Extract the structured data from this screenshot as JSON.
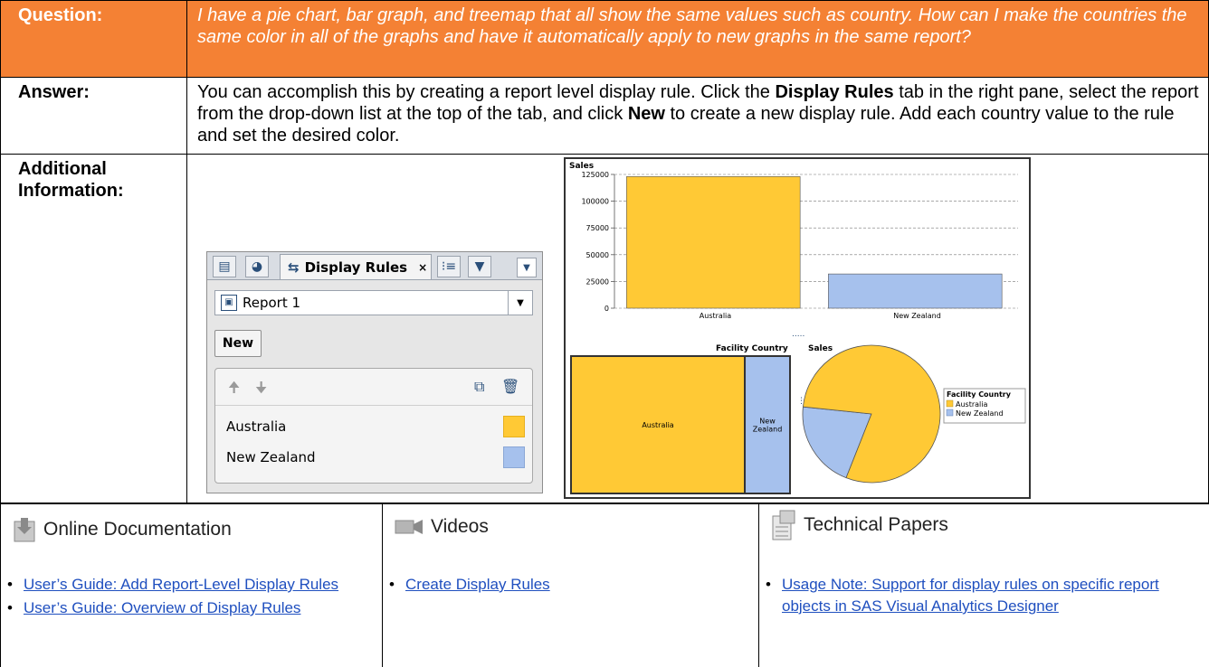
{
  "qa": {
    "question_label": "Question:",
    "question_text": "I have a pie chart, bar graph, and treemap that all show the same values such as country. How can I make the countries the same color in all of the graphs and have it automatically apply to new graphs in the same report?",
    "answer_label": "Answer:",
    "answer_part1": "You can accomplish this by creating a report level display rule. Click the ",
    "answer_bold1": "Display Rules",
    "answer_part2": " tab in the right pane, select the report from the drop-down list at the top of the tab, and click ",
    "answer_bold2": "New",
    "answer_part3": " to create a new display rule. Add each country value to the rule and set the desired color.",
    "additional_label": "Additional Information:"
  },
  "panel": {
    "tab_label": "Display Rules",
    "tab_close": "×",
    "report_value": "Report 1",
    "new_button": "New",
    "rules": [
      {
        "label": "Australia",
        "color": "#ffc935"
      },
      {
        "label": "New Zealand",
        "color": "#a6c1ed"
      }
    ]
  },
  "chart_data": [
    {
      "type": "bar",
      "title": "Sales",
      "categories": [
        "Australia",
        "New Zealand"
      ],
      "values": [
        123000,
        32000
      ],
      "ylim": [
        0,
        125000
      ],
      "yticks": [
        0,
        25000,
        50000,
        75000,
        100000,
        125000
      ],
      "colors": [
        "#ffc935",
        "#a6c1ed"
      ]
    },
    {
      "type": "treemap",
      "categories": [
        "Australia",
        "New Zealand"
      ],
      "labels": [
        "Australia",
        "New Zealand"
      ],
      "values": [
        123000,
        32000
      ],
      "colors": [
        "#ffc935",
        "#a6c1ed"
      ]
    },
    {
      "type": "pie",
      "categories": [
        "Australia",
        "New Zealand"
      ],
      "values": [
        123000,
        32000
      ],
      "legend_title": "Facility Country",
      "colors": [
        "#ffc935",
        "#a6c1ed"
      ]
    }
  ],
  "charts_header": {
    "left": "Facility Country",
    "right": "Sales",
    "dots": "....."
  },
  "resources": {
    "docs_title": "Online Documentation",
    "docs_links": [
      "User’s Guide: Add Report-Level Display Rules",
      "User’s Guide: Overview of Display Rules"
    ],
    "videos_title": "Videos",
    "videos_links": [
      "Create Display Rules"
    ],
    "papers_title": "Technical Papers",
    "papers_links": [
      "Usage Note: Support for display rules on specific report objects in SAS Visual Analytics Designer"
    ]
  }
}
